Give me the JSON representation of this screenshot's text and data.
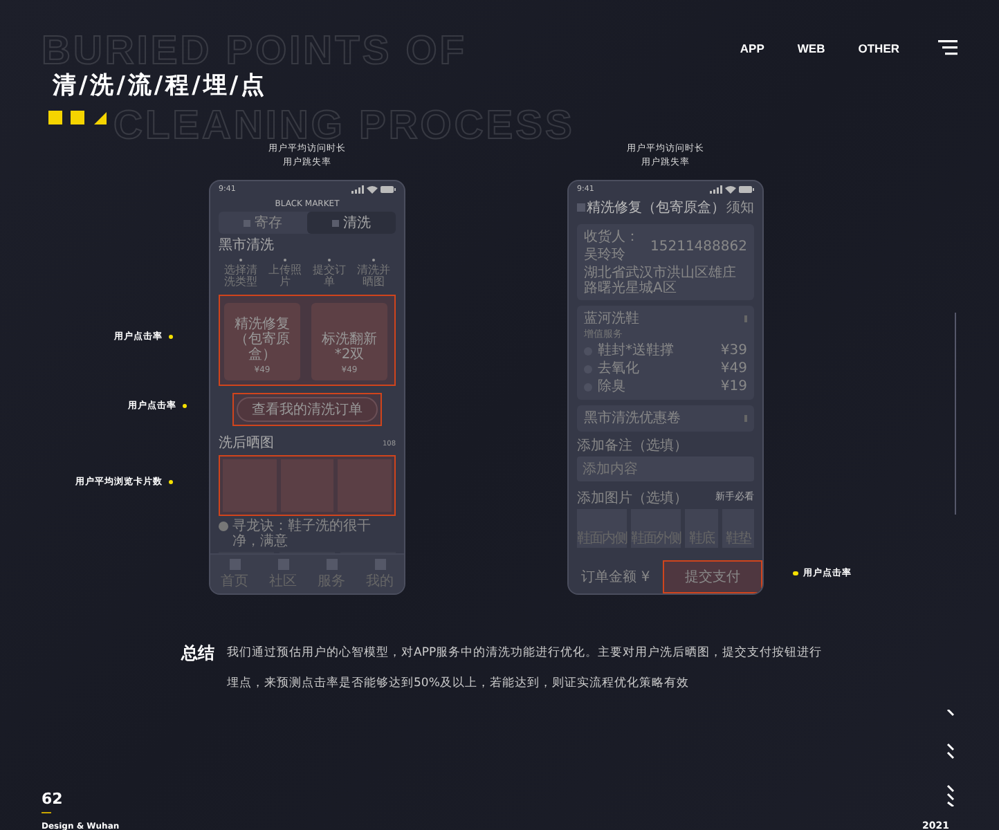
{
  "header": {
    "backdrop_lines": [
      "BURIED POINTS OF",
      "CLEANING PROCESS"
    ],
    "title": "清/洗/流/程/埋/点"
  },
  "nav": {
    "links": [
      "APP",
      "WEB",
      "OTHER"
    ]
  },
  "phones": [
    {
      "kind": "home",
      "metrics": [
        "用户平均访问时长",
        "用户跳失率"
      ],
      "time": "9:41",
      "brand": "BLACK MARKET",
      "tabs": [
        {
          "label": "寄存",
          "selected": false
        },
        {
          "label": "清洗",
          "selected": true
        }
      ],
      "section_title": "黑市清洗",
      "steps": [
        "选择清洗类型",
        "上传照片",
        "提交订单",
        "清洗并晒图"
      ],
      "services": {
        "highlighted": true,
        "annotation": "用户点击率",
        "cards": [
          {
            "name": "精洗修复（包寄原盒）",
            "price": "¥49"
          },
          {
            "name": "标洗翻新*2双",
            "price": "¥49"
          }
        ]
      },
      "order_button": {
        "label": "查看我的清洗订单",
        "highlighted": true,
        "annotation": "用户点击率"
      },
      "gallery": {
        "title": "洗后晒图",
        "count": "108",
        "highlighted": true,
        "annotation": "用户平均浏览卡片数"
      },
      "review": "寻龙诀：鞋子洗的很干净，满意",
      "tab_bar": [
        "首页",
        "社区",
        "服务",
        "我的"
      ]
    },
    {
      "kind": "checkout",
      "metrics": [
        "用户平均访问时长",
        "用户跳失率"
      ],
      "time": "9:41",
      "title": "精洗修复（包寄原盒）",
      "header_link": "须知",
      "address": {
        "recipient": "收货人：吴玲玲",
        "phone": "15211488862",
        "line": "湖北省武汉市洪山区雄庄路曙光星城A区"
      },
      "service": {
        "title": "蓝河洗鞋",
        "subtitle": "增值服务",
        "options": [
          {
            "name": "鞋封*送鞋撑",
            "price": "¥39",
            "checked": false
          },
          {
            "name": "去氧化",
            "price": "¥49",
            "checked": false
          },
          {
            "name": "除臭",
            "price": "¥19",
            "checked": false
          }
        ]
      },
      "coupon": "黑市清洗优惠卷",
      "note": {
        "label": "添加备注（选填）",
        "placeholder": "添加内容"
      },
      "photos": {
        "label": "添加图片（选填）",
        "link": "新手必看",
        "slots": [
          "鞋面内侧",
          "鞋面外侧",
          "鞋底",
          "鞋垫"
        ]
      },
      "footer": {
        "total": "订单金额 ¥",
        "submit": {
          "label": "提交支付",
          "highlighted": true,
          "annotation": "用户点击率"
        }
      }
    }
  ],
  "summary": {
    "heading": "总结",
    "text": "我们通过预估用户的心智模型，对APP服务中的清洗功能进行优化。主要对用户洗后晒图，提交支付按钮进行埋点，来预测点击率是否能够达到50%及以上，若能达到，则证实流程优化策略有效"
  },
  "footer": {
    "page": "62",
    "credit": "Design & Wuhan",
    "year": "2021"
  }
}
